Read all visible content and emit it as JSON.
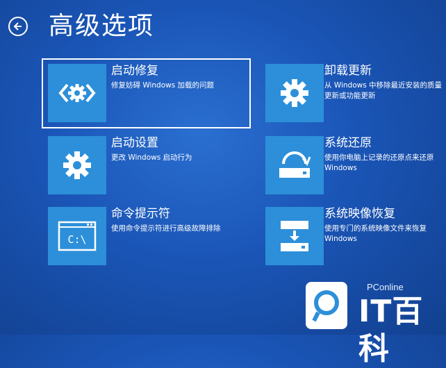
{
  "header": {
    "title": "高级选项"
  },
  "options": [
    {
      "title": "启动修复",
      "desc": "修复妨碍 Windows 加载的问题",
      "icon": "startup-repair-icon"
    },
    {
      "title": "启动设置",
      "desc": "更改 Windows 启动行为",
      "icon": "gear-icon"
    },
    {
      "title": "命令提示符",
      "desc": "使用命令提示符进行高级故障排除",
      "icon": "command-prompt-icon"
    },
    {
      "title": "卸载更新",
      "desc": "从 Windows 中移除最近安装的质量更新或功能更新",
      "icon": "gear-icon"
    },
    {
      "title": "系统还原",
      "desc": "使用你电脑上记录的还原点来还原 Windows",
      "icon": "system-restore-icon"
    },
    {
      "title": "系统映像恢复",
      "desc": "使用专门的系统映像文件来恢复 Windows",
      "icon": "image-recovery-icon"
    }
  ],
  "cmd_glyph": "C:\\",
  "watermark": {
    "site": "PConline",
    "brand": "IT百科"
  },
  "colors": {
    "background": "#1a55b6",
    "tile": "#2d8fd9",
    "text": "#ffffff"
  }
}
